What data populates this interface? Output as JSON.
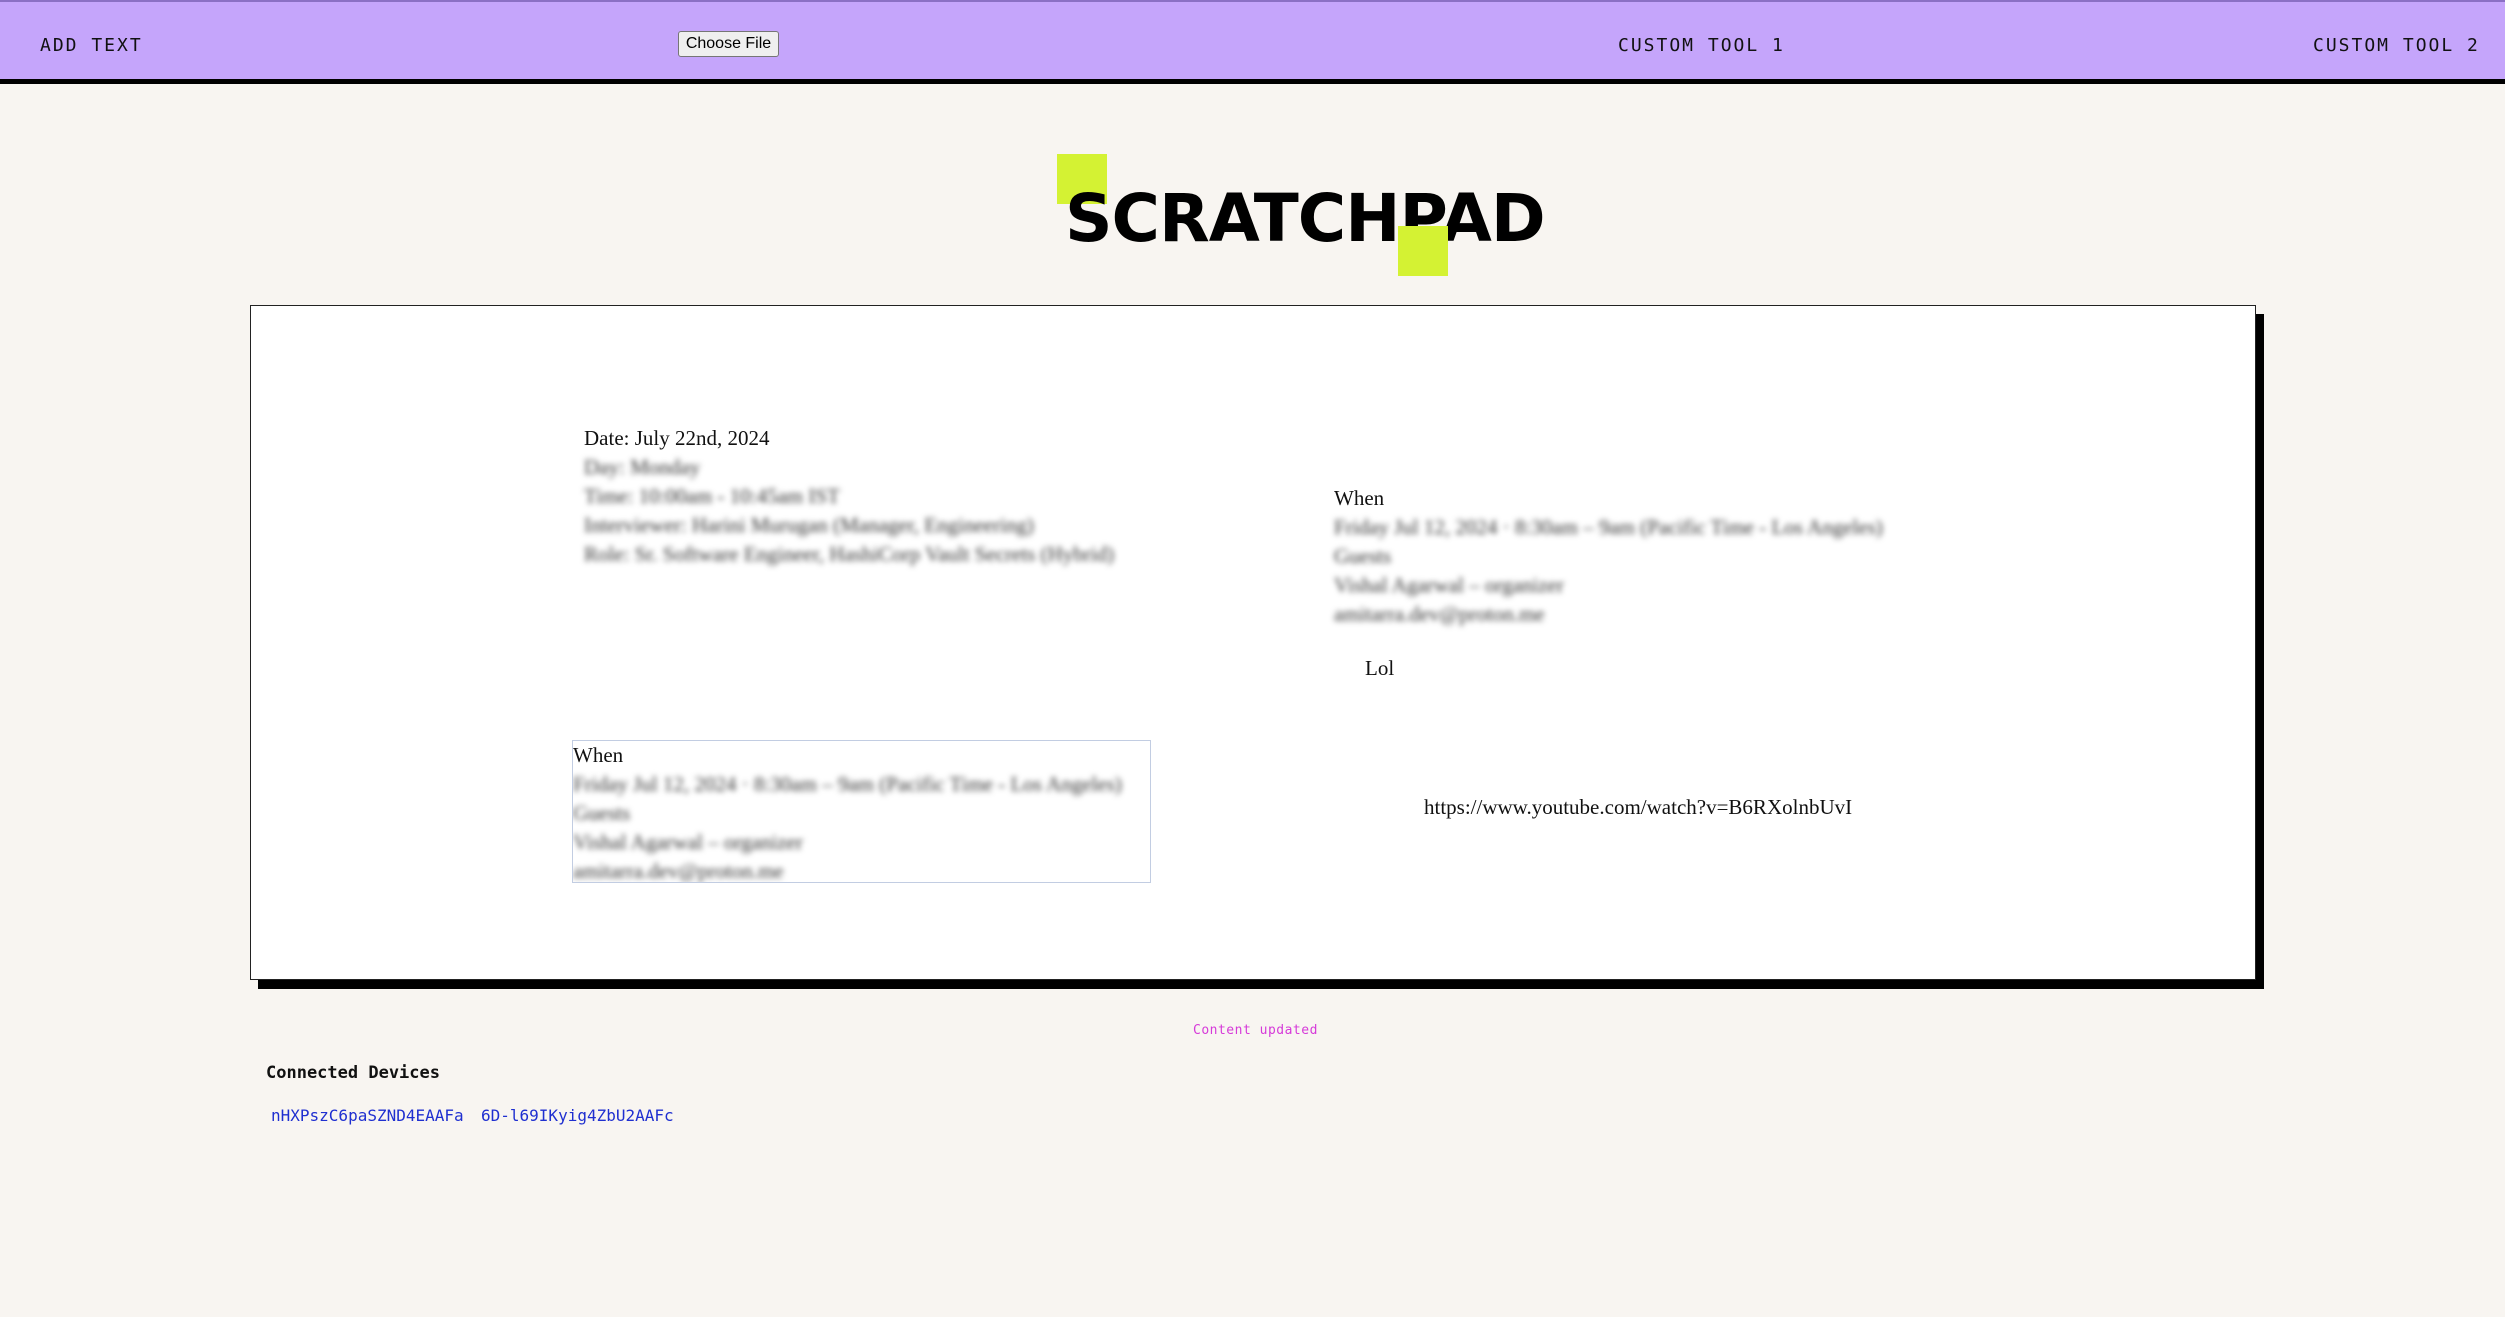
{
  "toolbar": {
    "add_text": "ADD TEXT",
    "file_button": "Choose File",
    "custom_tool_1": "CUSTOM TOOL 1",
    "custom_tool_2": "CUSTOM TOOL 2"
  },
  "title": "SCRATCHPAD",
  "notes": {
    "interview": {
      "date": "Date: July 22nd, 2024",
      "lines": [
        "Day: Monday",
        "Time: 10:00am - 10:45am IST",
        "Interviewer: Harini Murugan (Manager, Engineering)",
        "Role: Sr. Software Engineer, HashiCorp Vault Secrets (Hybrid)"
      ]
    },
    "when_right": {
      "heading": "When",
      "lines": [
        "Friday Jul 12, 2024 · 8:30am – 9am (Pacific Time - Los Angeles)",
        "Guests",
        "Vishal Agarwal – organizer",
        "amitarra.dev@proton.me"
      ]
    },
    "lol": "Lol",
    "when_left": {
      "heading": "When",
      "lines": [
        "Friday Jul 12, 2024 · 8:30am – 9am (Pacific Time - Los Angeles)",
        "Guests",
        "Vishal Agarwal – organizer",
        "amitarra.dev@proton.me"
      ]
    },
    "url": "https://www.youtube.com/watch?v=B6RXolnbUvI"
  },
  "status": "Content updated",
  "devices": {
    "title": "Connected Devices",
    "items": [
      "nHXPszC6paSZND4EAAFa",
      "6D-l69IKyig4ZbU2AAFc"
    ]
  },
  "colors": {
    "toolbar_bg": "#c5a5fb",
    "accent_square": "#d4f233",
    "status": "#d63ad9",
    "device_link": "#1f2fd0"
  }
}
